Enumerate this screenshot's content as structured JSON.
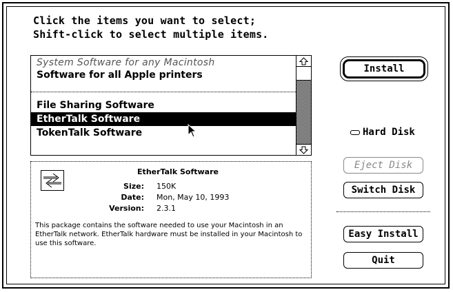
{
  "instructions": {
    "line1": "Click the items you want to select;",
    "line2": "Shift-click to select multiple items."
  },
  "software_list": {
    "items": [
      {
        "label": "System Software for any Macintosh",
        "state": "dimmed"
      },
      {
        "label": "Software for all Apple printers",
        "state": "normal"
      },
      {
        "label": "File Sharing Software",
        "state": "normal"
      },
      {
        "label": "EtherTalk Software",
        "state": "selected"
      },
      {
        "label": "TokenTalk Software",
        "state": "normal"
      }
    ],
    "scroll_up_icon": "scroll-up-arrow-icon",
    "scroll_down_icon": "scroll-down-arrow-icon"
  },
  "info": {
    "icon": "network-package-icon",
    "title": "EtherTalk Software",
    "size_label": "Size:",
    "size_value": "150K",
    "date_label": "Date:",
    "date_value": "Mon, May 10, 1993",
    "version_label": "Version:",
    "version_value": "2.3.1",
    "description": "This package contains the software needed to use your Macintosh in an EtherTalk network.  EtherTalk hardware must be installed in your Macintosh to use this software."
  },
  "buttons": {
    "install": "Install",
    "eject_disk": "Eject Disk",
    "switch_disk": "Switch Disk",
    "easy_install": "Easy Install",
    "quit": "Quit"
  },
  "disk": {
    "icon": "hard-disk-icon",
    "name": "Hard Disk"
  },
  "colors": {
    "selection_bg": "#000000",
    "selection_fg": "#ffffff",
    "disabled": "#888888"
  }
}
